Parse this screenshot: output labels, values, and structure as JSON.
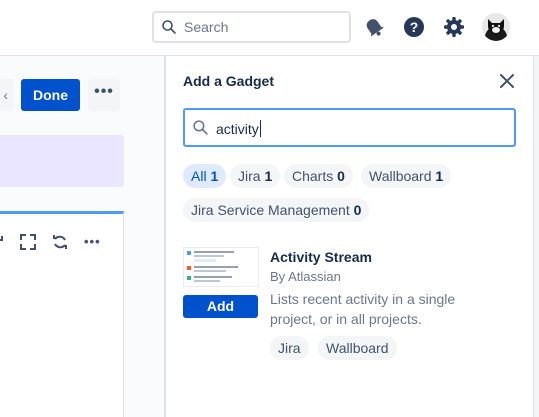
{
  "header": {
    "search": {
      "placeholder": "Search"
    }
  },
  "dashboard": {
    "done_label": "Done",
    "more_label": "•••",
    "gadget_more_label": "•••"
  },
  "panel": {
    "title": "Add a Gadget",
    "filter_value": "activity",
    "categories": [
      {
        "label": "All",
        "count": "1"
      },
      {
        "label": "Jira",
        "count": "1"
      },
      {
        "label": "Charts",
        "count": "0"
      },
      {
        "label": "Wallboard",
        "count": "1"
      },
      {
        "label": "Jira Service Management",
        "count": "0"
      }
    ],
    "results": [
      {
        "title": "Activity Stream",
        "author": "By Atlassian",
        "description": "Lists recent activity in a single project, or in all projects.",
        "add_label": "Add",
        "tags": [
          "Jira",
          "Wallboard"
        ]
      }
    ]
  },
  "colors": {
    "primary": "#0052cc",
    "focus": "#4c9aff",
    "selected_chip": "#deebff",
    "highlight_band": "#eae6ff",
    "text": "#172b4d",
    "muted": "#6b778c"
  },
  "icons": [
    "search-icon",
    "notifications-icon",
    "help-icon",
    "settings-icon",
    "avatar",
    "fullscreen-icon",
    "refresh-icon",
    "close-icon"
  ]
}
